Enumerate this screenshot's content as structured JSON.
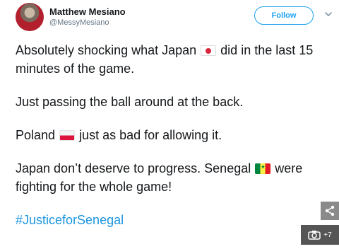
{
  "author": {
    "name": "Matthew Mesiano",
    "handle": "@MessyMesiano",
    "avatar_icon": "profile-photo"
  },
  "follow_label": "Follow",
  "tweet": {
    "line1_before_flag": "Absolutely shocking what Japan",
    "line1_after_flag": "did in the last 15 minutes of the game.",
    "para2": "Just passing the ball around at the back.",
    "para3_before_flag": "Poland",
    "para3_after_flag": "just as bad for allowing it.",
    "para4_before_flag": "Japan don’t deserve to progress. Senegal",
    "para4_after_flag": "were fighting for the whole game!",
    "hashtag": "#JusticeforSenegal"
  },
  "overlay": {
    "share_icon": "share-icon",
    "gallery_icon": "camera-icon",
    "gallery_count": "+7"
  },
  "colors": {
    "accent": "#1da1f2",
    "hashtag": "#1b95e0",
    "text": "#14171a",
    "muted": "#657786"
  }
}
